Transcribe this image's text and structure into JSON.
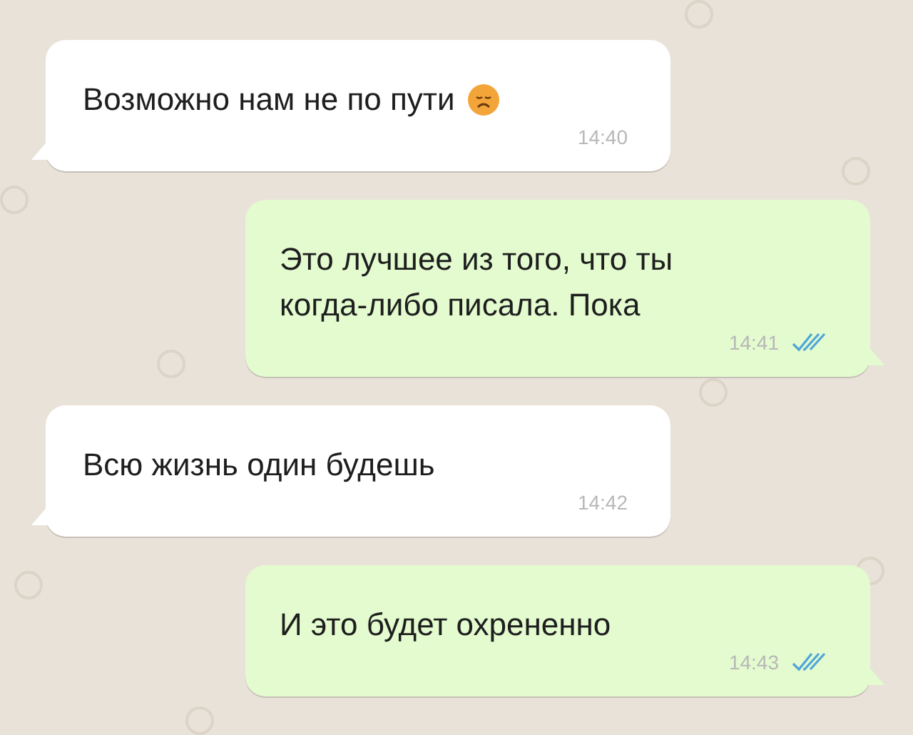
{
  "messages": [
    {
      "kind": "incoming",
      "text": "Возможно нам не по пути",
      "emoji": true,
      "time": "14:40"
    },
    {
      "kind": "outgoing",
      "text": "Это лучшее из того, что ты\nкогда-либо писала. Пока",
      "emoji": false,
      "time": "14:41",
      "read": true
    },
    {
      "kind": "incoming",
      "text": "Всю жизнь один будешь",
      "emoji": false,
      "time": "14:42"
    },
    {
      "kind": "outgoing",
      "text": "И это будет охрененно",
      "emoji": false,
      "time": "14:43",
      "read": true
    }
  ]
}
